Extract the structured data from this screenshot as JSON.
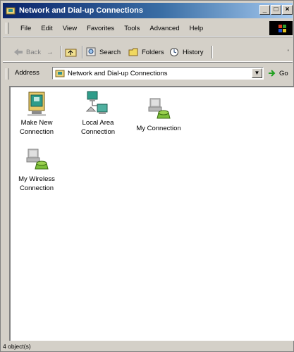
{
  "window": {
    "title": "Network and Dial-up Connections"
  },
  "title_buttons": {
    "minimize": "_",
    "maximize": "□",
    "close": "×"
  },
  "menu": [
    "File",
    "Edit",
    "View",
    "Favorites",
    "Tools",
    "Advanced",
    "Help"
  ],
  "toolbar": {
    "back": "Back",
    "forward": "→",
    "up": "",
    "search": "Search",
    "folders": "Folders",
    "history": "History"
  },
  "address": {
    "label": "Address",
    "value": "Network and Dial-up Connections",
    "go": "Go"
  },
  "items": [
    {
      "label_line1": "Make New",
      "label_line2": "Connection",
      "icon": "make-new-connection-icon"
    },
    {
      "label_line1": "Local Area",
      "label_line2": "Connection",
      "icon": "lan-connection-icon"
    },
    {
      "label_line1": "My Connection",
      "label_line2": "",
      "icon": "dialup-connection-icon"
    },
    {
      "label_line1": "My Wireless",
      "label_line2": "Connection",
      "icon": "dialup-connection-icon"
    }
  ],
  "status": {
    "text": "4 object(s)"
  },
  "colors": {
    "title_start": "#0a246a",
    "title_end": "#a6caf0",
    "face": "#d4d0c8"
  }
}
